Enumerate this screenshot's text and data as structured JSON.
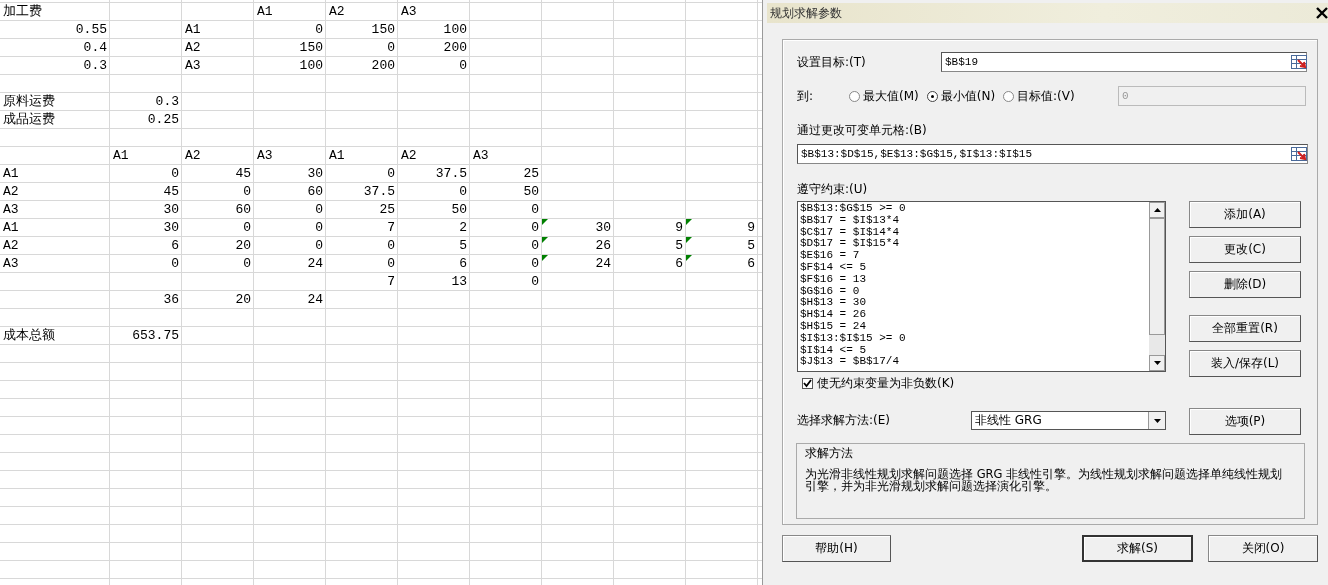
{
  "sheet": {
    "rows": [
      [
        {
          "text": "加工费",
          "kind": "label"
        },
        null,
        null,
        {
          "text": "A1",
          "kind": "label"
        },
        {
          "text": "A2",
          "kind": "label"
        },
        {
          "text": "A3",
          "kind": "label"
        }
      ],
      [
        {
          "text": "0.55",
          "kind": "number"
        },
        null,
        {
          "text": "A1",
          "kind": "label"
        },
        {
          "text": "0",
          "kind": "number"
        },
        {
          "text": "150",
          "kind": "number"
        },
        {
          "text": "100",
          "kind": "number"
        }
      ],
      [
        {
          "text": "0.4",
          "kind": "number"
        },
        null,
        {
          "text": "A2",
          "kind": "label"
        },
        {
          "text": "150",
          "kind": "number"
        },
        {
          "text": "0",
          "kind": "number"
        },
        {
          "text": "200",
          "kind": "number"
        }
      ],
      [
        {
          "text": "0.3",
          "kind": "number"
        },
        null,
        {
          "text": "A3",
          "kind": "label"
        },
        {
          "text": "100",
          "kind": "number"
        },
        {
          "text": "200",
          "kind": "number"
        },
        {
          "text": "0",
          "kind": "number"
        }
      ],
      [],
      [
        {
          "text": "原料运费",
          "kind": "label"
        },
        {
          "text": "0.3",
          "kind": "number"
        }
      ],
      [
        {
          "text": "成品运费",
          "kind": "label"
        },
        {
          "text": "0.25",
          "kind": "number"
        }
      ],
      [],
      [
        null,
        {
          "text": "A1",
          "kind": "label"
        },
        {
          "text": "A2",
          "kind": "label"
        },
        {
          "text": "A3",
          "kind": "label"
        },
        {
          "text": "A1",
          "kind": "label"
        },
        {
          "text": "A2",
          "kind": "label"
        },
        {
          "text": "A3",
          "kind": "label"
        }
      ],
      [
        {
          "text": "A1",
          "kind": "label"
        },
        {
          "text": "0",
          "kind": "number"
        },
        {
          "text": "45",
          "kind": "number"
        },
        {
          "text": "30",
          "kind": "number"
        },
        {
          "text": "0",
          "kind": "number"
        },
        {
          "text": "37.5",
          "kind": "number"
        },
        {
          "text": "25",
          "kind": "number"
        }
      ],
      [
        {
          "text": "A2",
          "kind": "label"
        },
        {
          "text": "45",
          "kind": "number"
        },
        {
          "text": "0",
          "kind": "number"
        },
        {
          "text": "60",
          "kind": "number"
        },
        {
          "text": "37.5",
          "kind": "number"
        },
        {
          "text": "0",
          "kind": "number"
        },
        {
          "text": "50",
          "kind": "number"
        }
      ],
      [
        {
          "text": "A3",
          "kind": "label"
        },
        {
          "text": "30",
          "kind": "number"
        },
        {
          "text": "60",
          "kind": "number"
        },
        {
          "text": "0",
          "kind": "number"
        },
        {
          "text": "25",
          "kind": "number"
        },
        {
          "text": "50",
          "kind": "number"
        },
        {
          "text": "0",
          "kind": "number"
        }
      ],
      [
        {
          "text": "A1",
          "kind": "label"
        },
        {
          "text": "30",
          "kind": "number"
        },
        {
          "text": "0",
          "kind": "number"
        },
        {
          "text": "0",
          "kind": "number"
        },
        {
          "text": "7",
          "kind": "number"
        },
        {
          "text": "2",
          "kind": "number"
        },
        {
          "text": "0",
          "kind": "number"
        },
        {
          "text": "30",
          "kind": "number",
          "flagged": true
        },
        {
          "text": "9",
          "kind": "number"
        },
        {
          "text": "9",
          "kind": "number",
          "flagged": true
        }
      ],
      [
        {
          "text": "A2",
          "kind": "label"
        },
        {
          "text": "6",
          "kind": "number"
        },
        {
          "text": "20",
          "kind": "number"
        },
        {
          "text": "0",
          "kind": "number"
        },
        {
          "text": "0",
          "kind": "number"
        },
        {
          "text": "5",
          "kind": "number"
        },
        {
          "text": "0",
          "kind": "number"
        },
        {
          "text": "26",
          "kind": "number",
          "flagged": true
        },
        {
          "text": "5",
          "kind": "number"
        },
        {
          "text": "5",
          "kind": "number",
          "flagged": true
        }
      ],
      [
        {
          "text": "A3",
          "kind": "label"
        },
        {
          "text": "0",
          "kind": "number"
        },
        {
          "text": "0",
          "kind": "number"
        },
        {
          "text": "24",
          "kind": "number"
        },
        {
          "text": "0",
          "kind": "number"
        },
        {
          "text": "6",
          "kind": "number"
        },
        {
          "text": "0",
          "kind": "number"
        },
        {
          "text": "24",
          "kind": "number",
          "flagged": true
        },
        {
          "text": "6",
          "kind": "number"
        },
        {
          "text": "6",
          "kind": "number",
          "flagged": true
        }
      ],
      [
        null,
        null,
        null,
        null,
        {
          "text": "7",
          "kind": "number"
        },
        {
          "text": "13",
          "kind": "number"
        },
        {
          "text": "0",
          "kind": "number"
        }
      ],
      [
        null,
        {
          "text": "36",
          "kind": "number"
        },
        {
          "text": "20",
          "kind": "number"
        },
        {
          "text": "24",
          "kind": "number"
        }
      ],
      [],
      [
        {
          "text": "成本总额",
          "kind": "label"
        },
        {
          "text": "653.75",
          "kind": "number"
        }
      ]
    ]
  },
  "dialog": {
    "title": "规划求解参数",
    "objective": {
      "label": "设置目标:(T)",
      "value": "$B$19"
    },
    "to": {
      "label": "到:",
      "options": [
        {
          "label": "最大值(M)",
          "selected": false
        },
        {
          "label": "最小值(N)",
          "selected": true
        },
        {
          "label": "目标值:(V)",
          "selected": false
        }
      ],
      "value": "0",
      "disabled": true
    },
    "changing_cells": {
      "label": "通过更改可变单元格:(B)",
      "value": "$B$13:$D$15,$E$13:$G$15,$I$13:$I$15"
    },
    "constraints": {
      "label": "遵守约束:(U)",
      "items": [
        "$B$13:$G$15 >= 0",
        "$B$17 = $I$13*4",
        "$C$17 = $I$14*4",
        "$D$17 = $I$15*4",
        "$E$16 = 7",
        "$F$14 <= 5",
        "$F$16 = 13",
        "$G$16 = 0",
        "$H$13 = 30",
        "$H$14 = 26",
        "$H$15 = 24",
        "$I$13:$I$15 >= 0",
        "$I$14 <= 5",
        "$J$13 = $B$17/4"
      ]
    },
    "side_buttons": [
      "添加(A)",
      "更改(C)",
      "删除(D)",
      "全部重置(R)",
      "装入/保存(L)"
    ],
    "nonnegative": {
      "label": "使无约束变量为非负数(K)",
      "checked": true
    },
    "method": {
      "label": "选择求解方法:(E)",
      "value": "非线性 GRG",
      "options_button": "选项(P)"
    },
    "method_info": {
      "title": "求解方法",
      "text": "为光滑非线性规划求解问题选择 GRG 非线性引擎。为线性规划求解问题选择单纯线性规划引擎，并为非光滑规划求解问题选择演化引擎。"
    },
    "footer_buttons": [
      {
        "label": "帮助(H)",
        "kind": "help"
      },
      {
        "label": "求解(S)",
        "kind": "primary"
      },
      {
        "label": "关闭(O)",
        "kind": "normal"
      }
    ]
  }
}
